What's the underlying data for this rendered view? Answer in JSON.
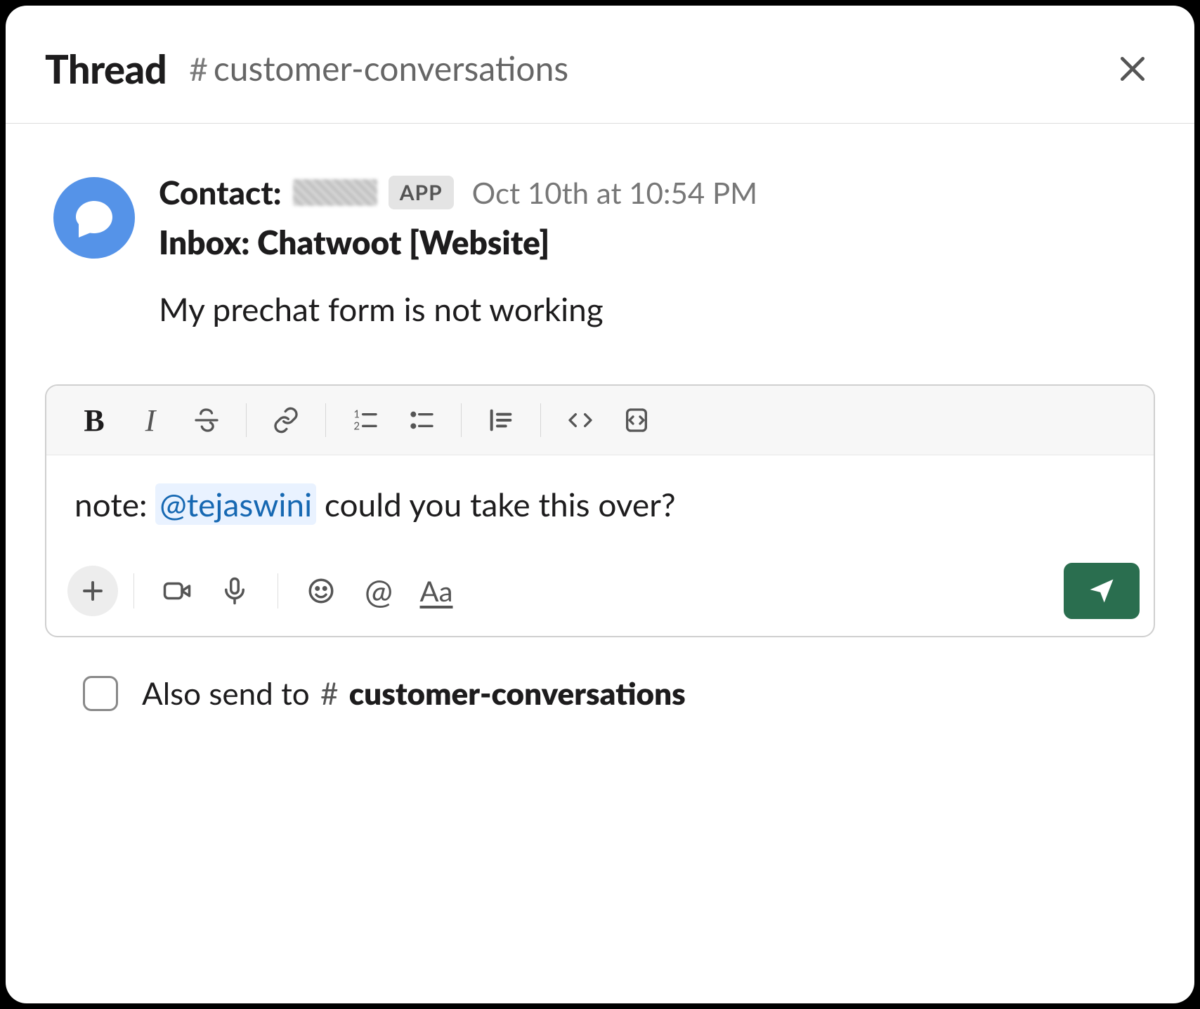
{
  "header": {
    "title": "Thread",
    "channel_hash": "#",
    "channel_name": "customer-conversations"
  },
  "message": {
    "sender_label": "Contact:",
    "app_badge": "APP",
    "timestamp": "Oct 10th at 10:54 PM",
    "inbox_line": "Inbox: Chatwoot [Website]",
    "body": "My prechat form is not working"
  },
  "composer": {
    "text_before": "note: ",
    "mention": "@tejaswini",
    "text_after": " could you take this over?"
  },
  "also_send": {
    "label_before": "Also send to ",
    "hash": "#",
    "channel": "customer-conversations"
  },
  "icons": {
    "close": "close-icon",
    "bold": "bold-icon",
    "italic": "italic-icon",
    "strike": "strikethrough-icon",
    "link": "link-icon",
    "ordered_list": "ordered-list-icon",
    "bullet_list": "bullet-list-icon",
    "blockquote": "blockquote-icon",
    "code": "code-icon",
    "code_block": "code-block-icon",
    "plus": "plus-icon",
    "video": "video-icon",
    "audio": "microphone-icon",
    "emoji": "emoji-icon",
    "at": "mention-icon",
    "formatting": "formatting-icon",
    "send": "send-icon"
  },
  "colors": {
    "accent": "#2a6e4f",
    "avatar": "#5593e8",
    "mention_bg": "#e9f2ff",
    "mention_fg": "#1668b2"
  }
}
